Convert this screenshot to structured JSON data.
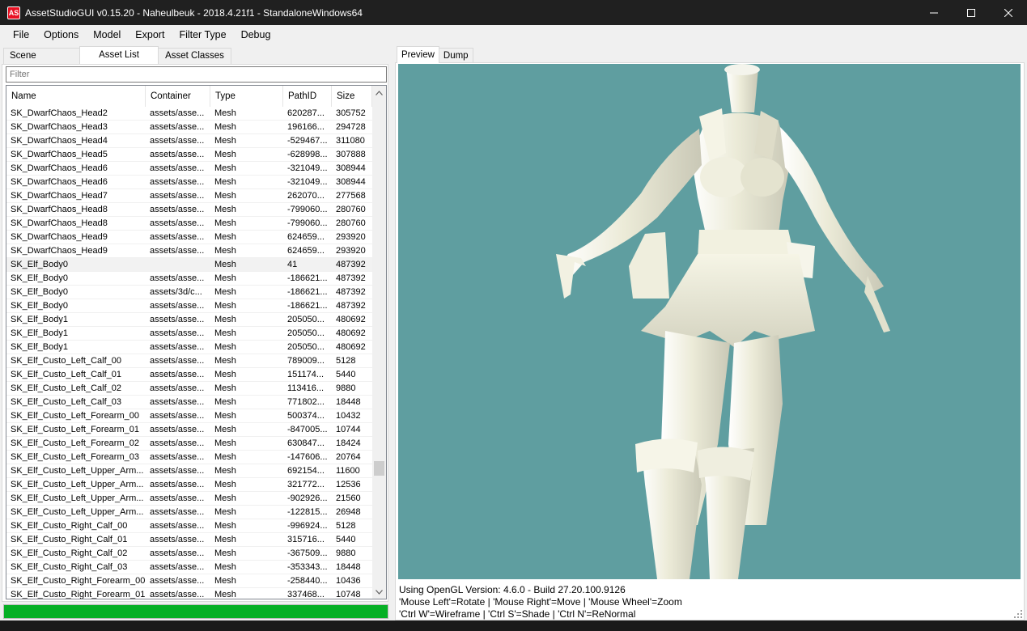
{
  "window": {
    "title": "AssetStudioGUI v0.15.20 - Naheulbeuk - 2018.4.21f1 - StandaloneWindows64",
    "app_icon_text": "AS"
  },
  "menu": [
    "File",
    "Options",
    "Model",
    "Export",
    "Filter Type",
    "Debug"
  ],
  "left_tabs": [
    "Scene Hierarchy",
    "Asset List",
    "Asset Classes"
  ],
  "filter": {
    "placeholder": "Filter",
    "value": ""
  },
  "columns": [
    "Name",
    "Container",
    "Type",
    "PathID",
    "Size"
  ],
  "rows": [
    {
      "name": "SK_DwarfChaos_Head2",
      "container": "assets/asse...",
      "type": "Mesh",
      "pathid": "620287...",
      "size": "305752"
    },
    {
      "name": "SK_DwarfChaos_Head3",
      "container": "assets/asse...",
      "type": "Mesh",
      "pathid": "196166...",
      "size": "294728"
    },
    {
      "name": "SK_DwarfChaos_Head4",
      "container": "assets/asse...",
      "type": "Mesh",
      "pathid": "-529467...",
      "size": "311080"
    },
    {
      "name": "SK_DwarfChaos_Head5",
      "container": "assets/asse...",
      "type": "Mesh",
      "pathid": "-628998...",
      "size": "307888"
    },
    {
      "name": "SK_DwarfChaos_Head6",
      "container": "assets/asse...",
      "type": "Mesh",
      "pathid": "-321049...",
      "size": "308944"
    },
    {
      "name": "SK_DwarfChaos_Head6",
      "container": "assets/asse...",
      "type": "Mesh",
      "pathid": "-321049...",
      "size": "308944"
    },
    {
      "name": "SK_DwarfChaos_Head7",
      "container": "assets/asse...",
      "type": "Mesh",
      "pathid": "262070...",
      "size": "277568"
    },
    {
      "name": "SK_DwarfChaos_Head8",
      "container": "assets/asse...",
      "type": "Mesh",
      "pathid": "-799060...",
      "size": "280760"
    },
    {
      "name": "SK_DwarfChaos_Head8",
      "container": "assets/asse...",
      "type": "Mesh",
      "pathid": "-799060...",
      "size": "280760"
    },
    {
      "name": "SK_DwarfChaos_Head9",
      "container": "assets/asse...",
      "type": "Mesh",
      "pathid": "624659...",
      "size": "293920"
    },
    {
      "name": "SK_DwarfChaos_Head9",
      "container": "assets/asse...",
      "type": "Mesh",
      "pathid": "624659...",
      "size": "293920"
    },
    {
      "name": "SK_Elf_Body0",
      "container": "",
      "type": "Mesh",
      "pathid": "41",
      "size": "487392",
      "selected": true
    },
    {
      "name": "SK_Elf_Body0",
      "container": "assets/asse...",
      "type": "Mesh",
      "pathid": "-186621...",
      "size": "487392"
    },
    {
      "name": "SK_Elf_Body0",
      "container": "assets/3d/c...",
      "type": "Mesh",
      "pathid": "-186621...",
      "size": "487392"
    },
    {
      "name": "SK_Elf_Body0",
      "container": "assets/asse...",
      "type": "Mesh",
      "pathid": "-186621...",
      "size": "487392"
    },
    {
      "name": "SK_Elf_Body1",
      "container": "assets/asse...",
      "type": "Mesh",
      "pathid": "205050...",
      "size": "480692"
    },
    {
      "name": "SK_Elf_Body1",
      "container": "assets/asse...",
      "type": "Mesh",
      "pathid": "205050...",
      "size": "480692"
    },
    {
      "name": "SK_Elf_Body1",
      "container": "assets/asse...",
      "type": "Mesh",
      "pathid": "205050...",
      "size": "480692"
    },
    {
      "name": "SK_Elf_Custo_Left_Calf_00",
      "container": "assets/asse...",
      "type": "Mesh",
      "pathid": "789009...",
      "size": "5128"
    },
    {
      "name": "SK_Elf_Custo_Left_Calf_01",
      "container": "assets/asse...",
      "type": "Mesh",
      "pathid": "151174...",
      "size": "5440"
    },
    {
      "name": "SK_Elf_Custo_Left_Calf_02",
      "container": "assets/asse...",
      "type": "Mesh",
      "pathid": "113416...",
      "size": "9880"
    },
    {
      "name": "SK_Elf_Custo_Left_Calf_03",
      "container": "assets/asse...",
      "type": "Mesh",
      "pathid": "771802...",
      "size": "18448"
    },
    {
      "name": "SK_Elf_Custo_Left_Forearm_00",
      "container": "assets/asse...",
      "type": "Mesh",
      "pathid": "500374...",
      "size": "10432"
    },
    {
      "name": "SK_Elf_Custo_Left_Forearm_01",
      "container": "assets/asse...",
      "type": "Mesh",
      "pathid": "-847005...",
      "size": "10744"
    },
    {
      "name": "SK_Elf_Custo_Left_Forearm_02",
      "container": "assets/asse...",
      "type": "Mesh",
      "pathid": "630847...",
      "size": "18424"
    },
    {
      "name": "SK_Elf_Custo_Left_Forearm_03",
      "container": "assets/asse...",
      "type": "Mesh",
      "pathid": "-147606...",
      "size": "20764"
    },
    {
      "name": "SK_Elf_Custo_Left_Upper_Arm...",
      "container": "assets/asse...",
      "type": "Mesh",
      "pathid": "692154...",
      "size": "11600"
    },
    {
      "name": "SK_Elf_Custo_Left_Upper_Arm...",
      "container": "assets/asse...",
      "type": "Mesh",
      "pathid": "321772...",
      "size": "12536"
    },
    {
      "name": "SK_Elf_Custo_Left_Upper_Arm...",
      "container": "assets/asse...",
      "type": "Mesh",
      "pathid": "-902926...",
      "size": "21560"
    },
    {
      "name": "SK_Elf_Custo_Left_Upper_Arm...",
      "container": "assets/asse...",
      "type": "Mesh",
      "pathid": "-122815...",
      "size": "26948"
    },
    {
      "name": "SK_Elf_Custo_Right_Calf_00",
      "container": "assets/asse...",
      "type": "Mesh",
      "pathid": "-996924...",
      "size": "5128"
    },
    {
      "name": "SK_Elf_Custo_Right_Calf_01",
      "container": "assets/asse...",
      "type": "Mesh",
      "pathid": "315716...",
      "size": "5440"
    },
    {
      "name": "SK_Elf_Custo_Right_Calf_02",
      "container": "assets/asse...",
      "type": "Mesh",
      "pathid": "-367509...",
      "size": "9880"
    },
    {
      "name": "SK_Elf_Custo_Right_Calf_03",
      "container": "assets/asse...",
      "type": "Mesh",
      "pathid": "-353343...",
      "size": "18448"
    },
    {
      "name": "SK_Elf_Custo_Right_Forearm_00",
      "container": "assets/asse...",
      "type": "Mesh",
      "pathid": "-258440...",
      "size": "10436"
    },
    {
      "name": "SK_Elf_Custo_Right_Forearm_01",
      "container": "assets/asse...",
      "type": "Mesh",
      "pathid": "337468...",
      "size": "10748"
    }
  ],
  "progress": {
    "fraction": 1.0,
    "color": "#06b025"
  },
  "right_tabs": [
    "Preview",
    "Dump"
  ],
  "preview": {
    "background": "#5f9ea0",
    "model_color": "#e9e9d4"
  },
  "status_lines": [
    "Using OpenGL Version: 4.6.0 - Build 27.20.100.9126",
    "'Mouse Left'=Rotate | 'Mouse Right'=Move | 'Mouse Wheel'=Zoom",
    "'Ctrl W'=Wireframe | 'Ctrl S'=Shade | 'Ctrl N'=ReNormal"
  ]
}
